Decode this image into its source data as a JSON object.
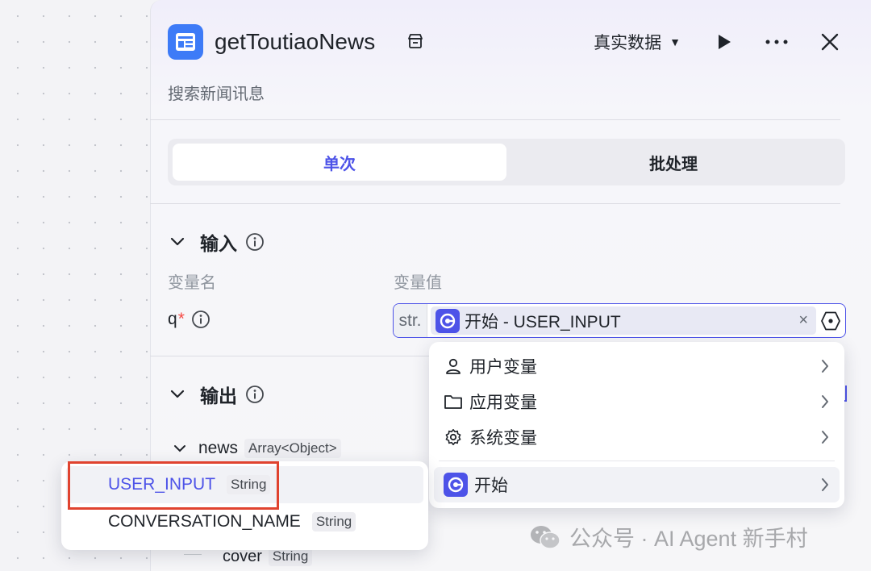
{
  "header": {
    "title": "getToutiaoNews",
    "subtitle": "搜索新闻讯息",
    "data_source": "真实数据"
  },
  "tabs": [
    {
      "label": "单次",
      "active": true
    },
    {
      "label": "批处理",
      "active": false
    }
  ],
  "input": {
    "section_title": "输入",
    "col_name": "变量名",
    "col_value": "变量值",
    "param_name": "q",
    "required_mark": "*",
    "value_type": "str.",
    "value_ref": "开始 - USER_INPUT",
    "clear_symbol": "×"
  },
  "dropdown": {
    "items": [
      {
        "icon": "user-icon",
        "label": "用户变量"
      },
      {
        "icon": "folder-icon",
        "label": "应用变量"
      },
      {
        "icon": "gear-icon",
        "label": "系统变量"
      }
    ],
    "start_item": {
      "icon": "start-node-icon",
      "label": "开始"
    }
  },
  "output": {
    "section_title": "输出",
    "news_field": "news",
    "news_type": "Array<Object>",
    "cover_field": "cover",
    "cover_type": "String"
  },
  "variable_popup": {
    "items": [
      {
        "name": "USER_INPUT",
        "type": "String",
        "selected": true
      },
      {
        "name": "CONVERSATION_NAME",
        "type": "String",
        "selected": false
      }
    ]
  },
  "watermark": "公众号 · AI Agent 新手村",
  "colors": {
    "accent": "#4d53e8",
    "header_icon": "#3d7bf7",
    "highlight_box": "#e0432f",
    "required": "#f54a45"
  }
}
